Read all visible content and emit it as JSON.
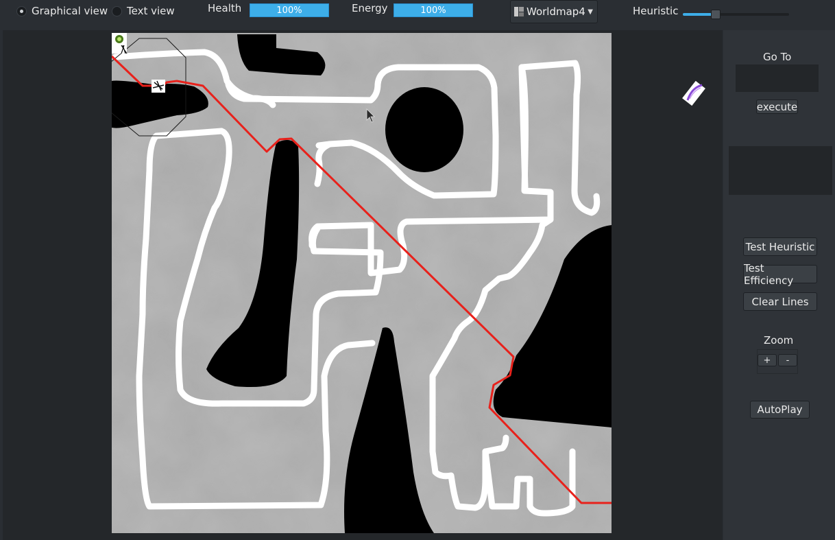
{
  "topbar": {
    "view_mode": {
      "options": [
        {
          "label": "Graphical view",
          "selected": true
        },
        {
          "label": "Text view",
          "selected": false
        }
      ]
    },
    "health": {
      "label": "Health",
      "value_text": "100%",
      "percent": 100
    },
    "energy": {
      "label": "Energy",
      "value_text": "100%",
      "percent": 100
    },
    "map_select": {
      "selected": "Worldmap4"
    },
    "heuristic": {
      "label": "Heuristic",
      "level_fraction": 0.3
    }
  },
  "sidepanel": {
    "goto_label": "Go To",
    "goto_value": "",
    "execute_label": "execute",
    "test_heuristic_label": "Test Heuristic",
    "test_efficiency_label": "Test Efficiency",
    "clear_lines_label": "Clear Lines",
    "zoom_label": "Zoom",
    "zoom_in_label": "+",
    "zoom_out_label": "-",
    "autoplay_label": "AutoPlay"
  },
  "map": {
    "path_color": "#e8211b",
    "wall_color": "#ffffff",
    "obstacle_color": "#000000"
  }
}
